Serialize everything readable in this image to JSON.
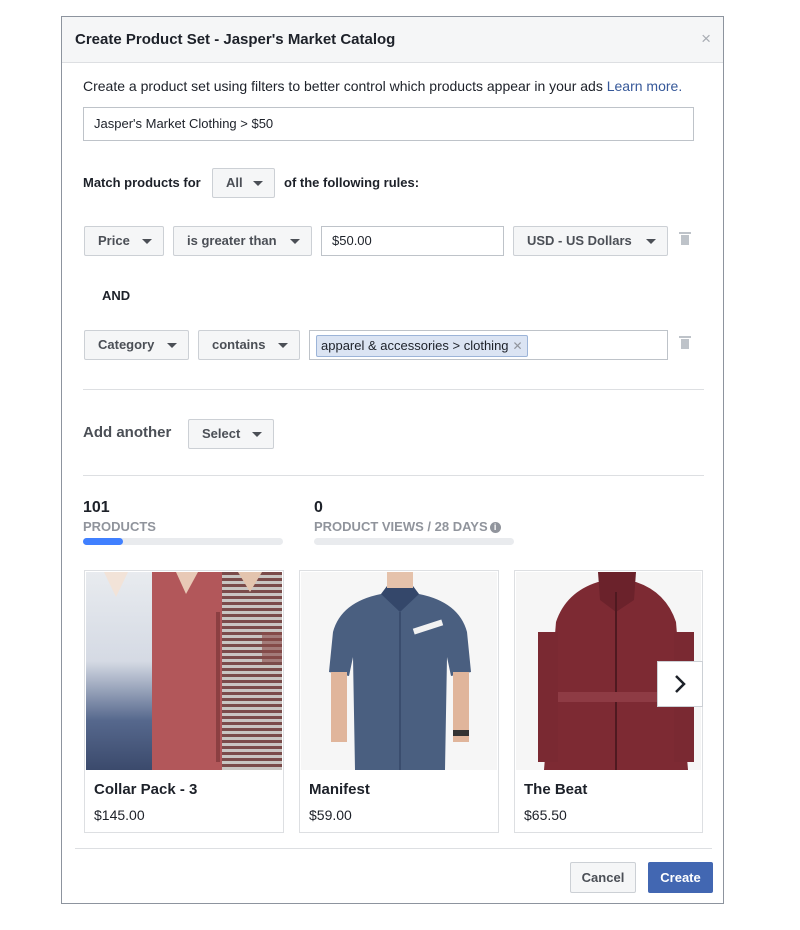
{
  "dialog": {
    "title": "Create Product Set - Jasper's Market Catalog",
    "close_glyph": "×"
  },
  "intro": {
    "text": "Create a product set using filters to better control which products appear in your ads ",
    "link": "Learn more."
  },
  "set_name": {
    "value": "Jasper's Market Clothing > $50"
  },
  "match": {
    "prefix": "Match products for",
    "mode": "All",
    "suffix": "of the following rules:"
  },
  "rules": [
    {
      "field": "Price",
      "operator": "is greater than",
      "value": "$50.00",
      "currency": "USD - US Dollars"
    },
    {
      "field": "Category",
      "operator": "contains",
      "token": "apparel & accessories > clothing"
    }
  ],
  "conjunction": "AND",
  "add_another": {
    "label": "Add another",
    "select": "Select"
  },
  "stats": {
    "products": {
      "count": "101",
      "label": "PRODUCTS",
      "fill_fraction": 0.2
    },
    "views": {
      "count": "0",
      "label": "PRODUCT VIEWS / 28 DAYS",
      "fill_fraction": 0
    }
  },
  "products": [
    {
      "name": "Collar Pack - 3",
      "price": "$145.00"
    },
    {
      "name": "Manifest",
      "price": "$59.00"
    },
    {
      "name": "The Beat",
      "price": "$65.50"
    }
  ],
  "footer": {
    "cancel": "Cancel",
    "create": "Create"
  },
  "colors": {
    "accent": "#4267b2",
    "link": "#365899",
    "bar": "#4080ff"
  }
}
